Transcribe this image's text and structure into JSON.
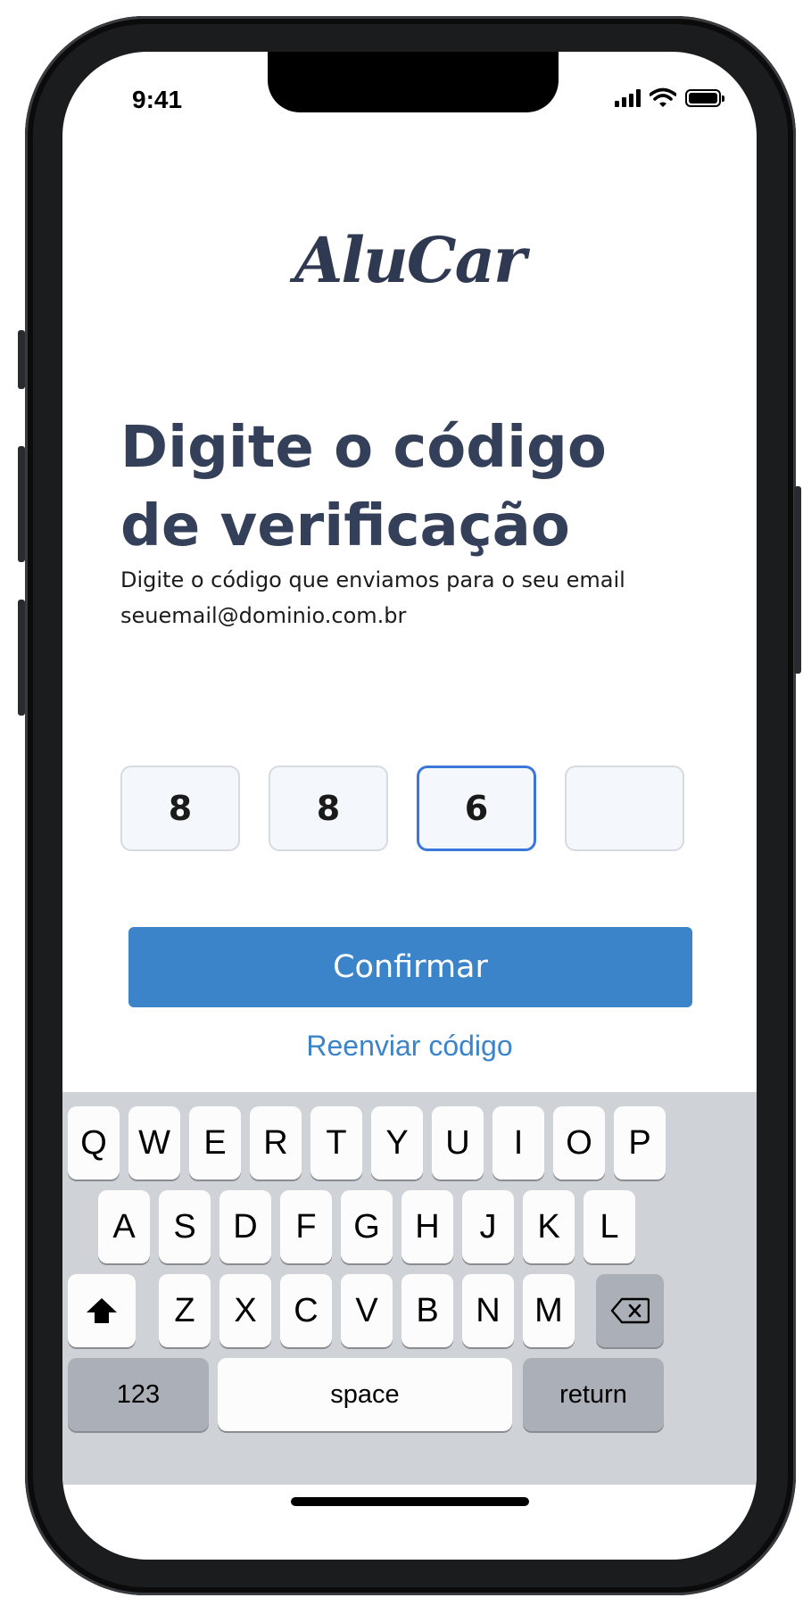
{
  "status_bar": {
    "time": "9:41"
  },
  "app": {
    "logo": "AluCar"
  },
  "header": {
    "title_line1": "Digite o código",
    "title_line2": "de verificação",
    "subtitle_line1": "Digite o código que enviamos para o seu email",
    "subtitle_line2": "seuemail@dominio.com.br"
  },
  "otp": {
    "digits": [
      "8",
      "8",
      "6",
      ""
    ],
    "active_index": 2
  },
  "actions": {
    "confirm_label": "Confirmar",
    "resend_label": "Reenviar código"
  },
  "keyboard": {
    "row1": [
      "Q",
      "W",
      "E",
      "R",
      "T",
      "Y",
      "U",
      "I",
      "O",
      "P"
    ],
    "row2": [
      "A",
      "S",
      "D",
      "F",
      "G",
      "H",
      "J",
      "K",
      "L"
    ],
    "row3": [
      "Z",
      "X",
      "C",
      "V",
      "B",
      "N",
      "M"
    ],
    "numbers_label": "123",
    "space_label": "space",
    "return_label": "return",
    "shift_icon": "shift-icon",
    "backspace_icon": "backspace-icon"
  },
  "colors": {
    "accent": "#3c84c9",
    "title": "#34405a",
    "focus": "#3b76d9"
  }
}
